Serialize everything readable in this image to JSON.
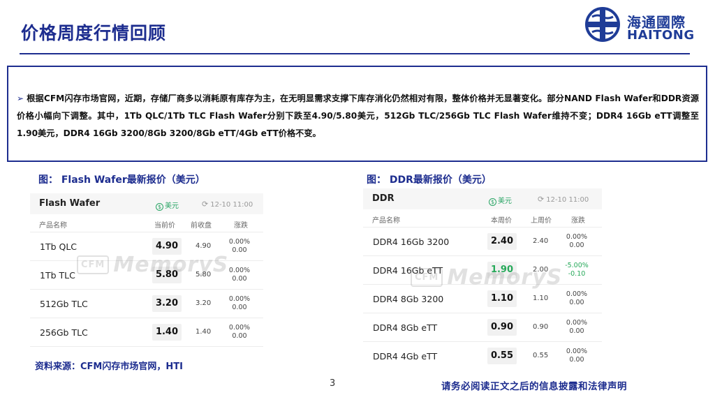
{
  "title": "价格周度行情回顾",
  "logo": {
    "cn": "海通國際",
    "en": "HAITONG",
    "icon": "haitong-logo-icon",
    "color": "#1f3c97"
  },
  "summary": {
    "bullet_icon": "arrow-bullet-icon",
    "text": "根据CFM闪存市场官网，近期，存储厂商多以消耗原有库存为主，在无明显需求支撑下库存消化仍然相对有限，整体价格并无显著变化。部分NAND Flash Wafer和DDR资源价格小幅向下调整。其中，1Tb QLC/1Tb TLC Flash Wafer分别下跌至4.90/5.80美元，512Gb TLC/256Gb TLC Flash Wafer维持不变；DDR4 16Gb eTT调整至1.90美元，DDR4 16Gb 3200/8Gb 3200/8Gb eTT/4Gb eTT价格不变。"
  },
  "figures": {
    "left_caption": "图：  Flash Wafer最新报价（美元）",
    "right_caption": "图：  DDR最新报价（美元）"
  },
  "flash_card": {
    "name": "Flash Wafer",
    "currency": "美元",
    "updated": "12-10 11:00",
    "columns": [
      "产品名称",
      "当前价",
      "前收盘",
      "涨跌"
    ],
    "rows": [
      {
        "product": "1Tb QLC",
        "current": "4.90",
        "previous": "4.90",
        "change_pct": "0.00%",
        "change_abs": "0.00",
        "trend": "flat"
      },
      {
        "product": "1Tb TLC",
        "current": "5.80",
        "previous": "5.80",
        "change_pct": "0.00%",
        "change_abs": "0.00",
        "trend": "flat"
      },
      {
        "product": "512Gb TLC",
        "current": "3.20",
        "previous": "3.20",
        "change_pct": "0.00%",
        "change_abs": "0.00",
        "trend": "flat"
      },
      {
        "product": "256Gb TLC",
        "current": "1.40",
        "previous": "1.40",
        "change_pct": "0.00%",
        "change_abs": "0.00",
        "trend": "flat"
      }
    ]
  },
  "ddr_card": {
    "name": "DDR",
    "currency": "美元",
    "updated": "12-10 11:00",
    "columns": [
      "产品名称",
      "本周价",
      "上周价",
      "涨跌"
    ],
    "rows": [
      {
        "product": "DDR4 16Gb 3200",
        "current": "2.40",
        "previous": "2.40",
        "change_pct": "0.00%",
        "change_abs": "0.00",
        "trend": "flat"
      },
      {
        "product": "DDR4 16Gb eTT",
        "current": "1.90",
        "previous": "2.00",
        "change_pct": "-5.00%",
        "change_abs": "-0.10",
        "trend": "down"
      },
      {
        "product": "DDR4 8Gb 3200",
        "current": "1.10",
        "previous": "1.10",
        "change_pct": "0.00%",
        "change_abs": "0.00",
        "trend": "flat"
      },
      {
        "product": "DDR4 8Gb eTT",
        "current": "0.90",
        "previous": "0.90",
        "change_pct": "0.00%",
        "change_abs": "0.00",
        "trend": "flat"
      },
      {
        "product": "DDR4 4Gb eTT",
        "current": "0.55",
        "previous": "0.55",
        "change_pct": "0.00%",
        "change_abs": "0.00",
        "trend": "flat"
      }
    ]
  },
  "watermark": {
    "badge": "CFM",
    "text": "MemoryS"
  },
  "source": "资料来源：CFM闪存市场官网，HTI",
  "page_number": "3",
  "disclaimer": "请务必阅读正文之后的信息披露和法律声明",
  "colors": {
    "brand_blue": "#1d2d8f",
    "down_green": "#27a95a"
  }
}
